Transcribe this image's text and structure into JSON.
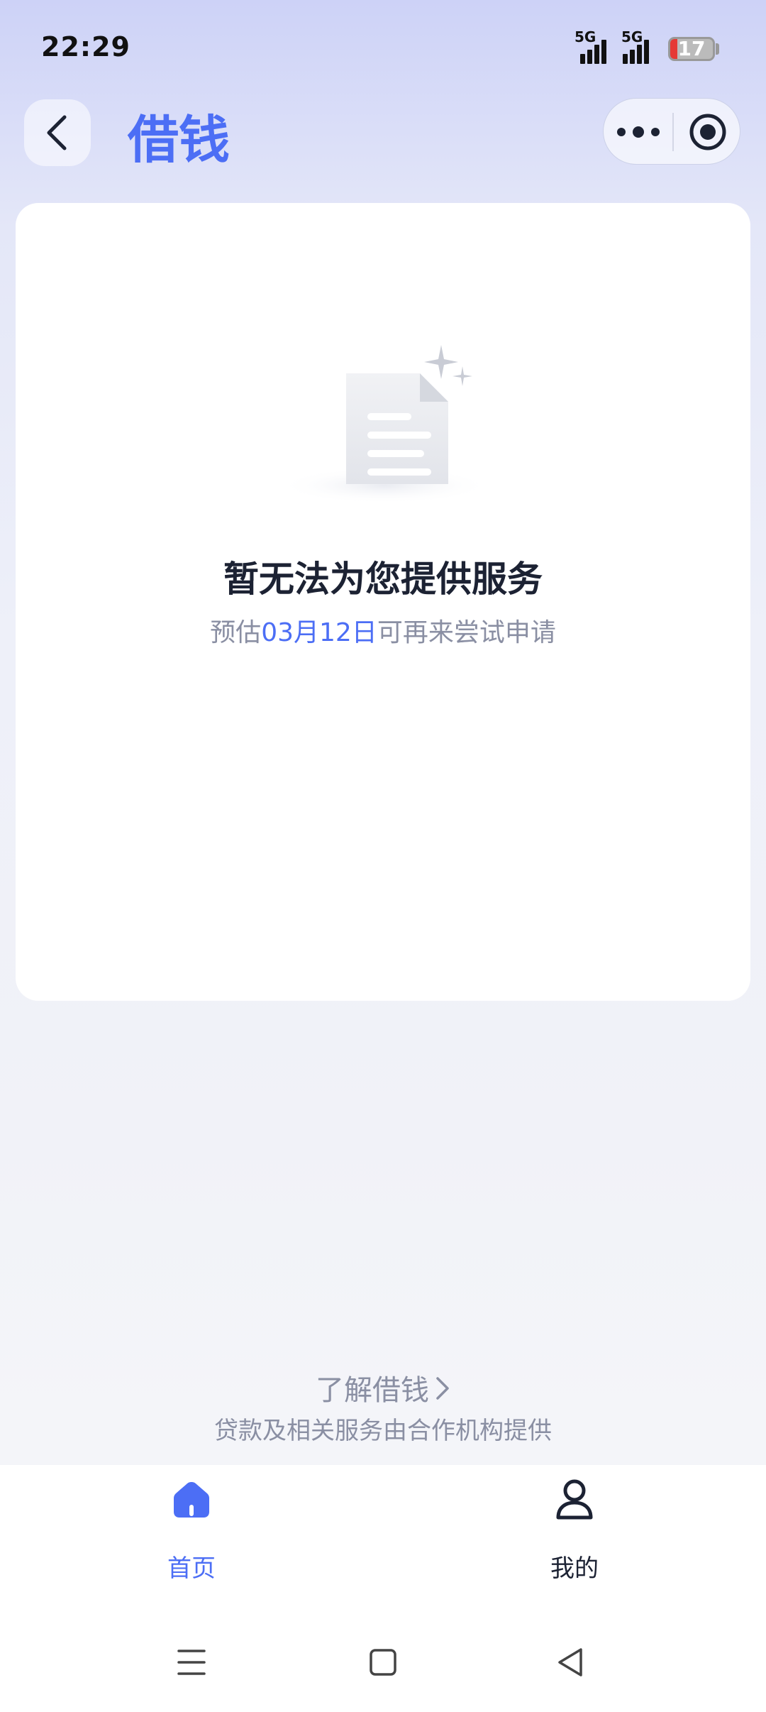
{
  "status_bar": {
    "time": "22:29",
    "network_1": "5G",
    "network_2": "5G",
    "battery": "17",
    "battery_level": 0.17
  },
  "header": {
    "title": "借钱"
  },
  "empty_state": {
    "title": "暂无法为您提供服务",
    "sub_prefix": "预估",
    "sub_date": "03月12日",
    "sub_suffix": "可再来尝试申请"
  },
  "footer": {
    "learn_more": "了解借钱",
    "disclaimer": "贷款及相关服务由合作机构提供"
  },
  "tabbar": {
    "tabs": [
      {
        "label": "首页",
        "icon": "home-icon",
        "active": true
      },
      {
        "label": "我的",
        "icon": "user-icon",
        "active": false
      }
    ]
  },
  "colors": {
    "accent": "#4c6ef5",
    "text_primary": "#1c2233",
    "text_secondary": "#8a8fa3"
  }
}
